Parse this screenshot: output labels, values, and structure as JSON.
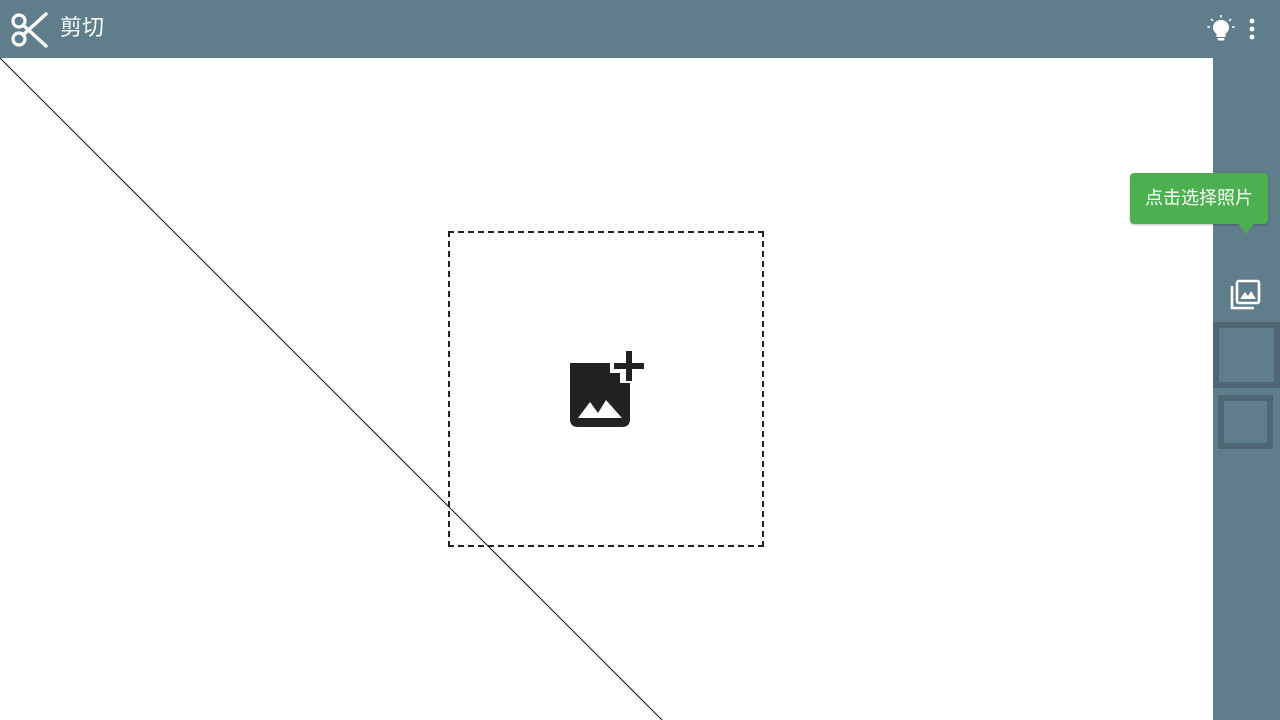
{
  "app_bar": {
    "title": "剪切",
    "logo_icon": "scissors-icon",
    "actions": [
      {
        "name": "tips",
        "icon": "lightbulb-icon"
      },
      {
        "name": "more",
        "icon": "more-vert-icon"
      }
    ]
  },
  "canvas": {
    "drop_zone_icon": "add-photo-icon"
  },
  "side_panel": {
    "tooltip": "点击选择照片",
    "gallery_icon": "photo-library-icon"
  },
  "colors": {
    "primary": "#607d8b",
    "primary_dark": "#4f6775",
    "accent_green": "#4caf50",
    "canvas_bg": "#ffffff",
    "icon_dark": "#222222"
  }
}
